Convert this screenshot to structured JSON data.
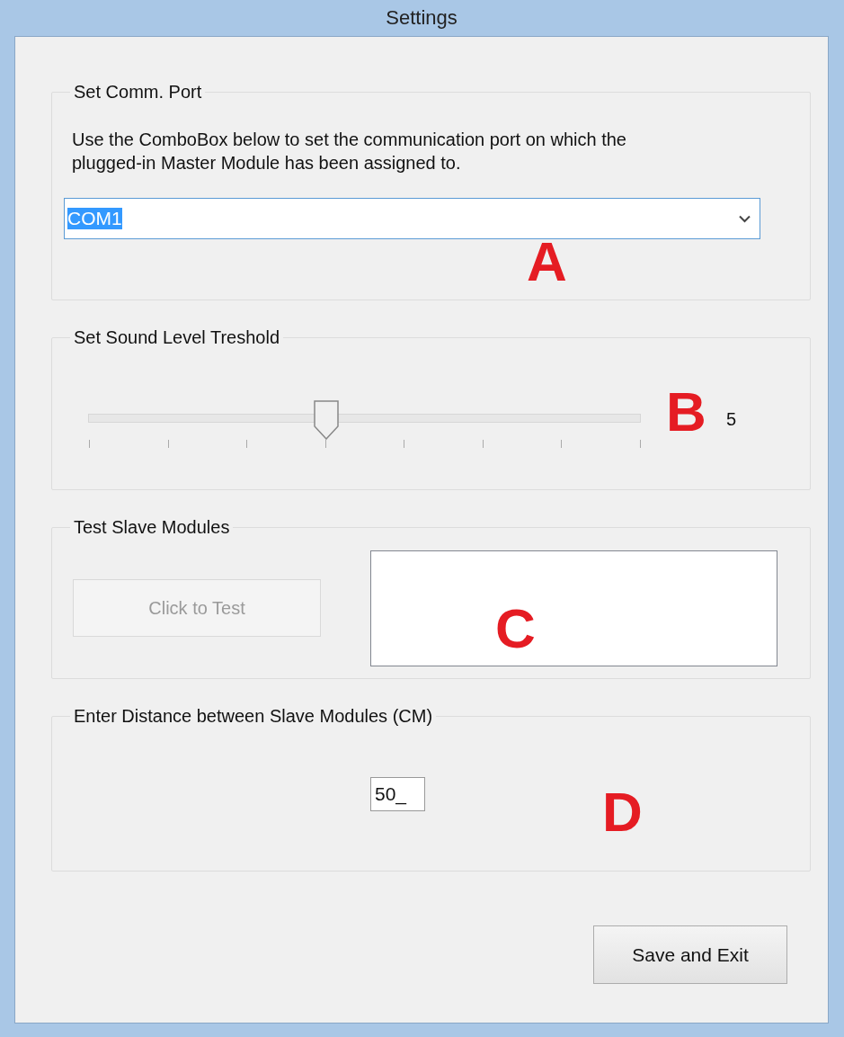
{
  "window": {
    "title": "Settings"
  },
  "comm_port": {
    "legend": "Set Comm. Port",
    "description": "Use the ComboBox below to set the communication port on which the plugged-in Master Module has been assigned to.",
    "combo": {
      "value": "COM1",
      "selected_text": true
    },
    "annotation": "A"
  },
  "sound_level": {
    "legend": "Set Sound Level Treshold",
    "slider": {
      "level": 0.43
    },
    "reading": "5",
    "annotation": "B"
  },
  "test_slaves": {
    "legend": "Test Slave Modules",
    "button": {
      "label": "Click to Test",
      "disabled": true
    },
    "annotation": "C"
  },
  "distance": {
    "legend": "Enter Distance between Slave Modules (CM)",
    "field": {
      "value": "50_"
    },
    "annotation": "D"
  },
  "buttons": [
    {
      "label": "Save and Exit"
    }
  ]
}
